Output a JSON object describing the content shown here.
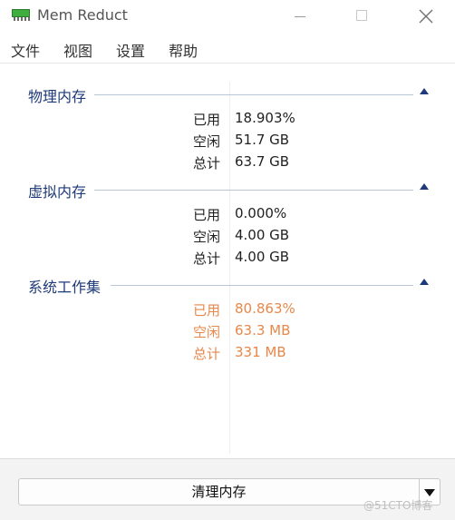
{
  "window": {
    "title": "Mem Reduct"
  },
  "menu": [
    "文件",
    "视图",
    "设置",
    "帮助"
  ],
  "groups": [
    {
      "title": "物理内存",
      "rows": [
        {
          "label": "已用",
          "value": "18.903%"
        },
        {
          "label": "空闲",
          "value": "51.7 GB"
        },
        {
          "label": "总计",
          "value": "63.7 GB"
        }
      ]
    },
    {
      "title": "虚拟内存",
      "rows": [
        {
          "label": "已用",
          "value": "0.000%"
        },
        {
          "label": "空闲",
          "value": "4.00 GB"
        },
        {
          "label": "总计",
          "value": "4.00 GB"
        }
      ]
    },
    {
      "title": "系统工作集",
      "rows": [
        {
          "label": "已用",
          "value": "80.863%"
        },
        {
          "label": "空闲",
          "value": "63.3 MB"
        },
        {
          "label": "总计",
          "value": "331 MB"
        }
      ]
    }
  ],
  "footer": {
    "clean_label": "清理内存",
    "watermark": "@51CTO博客"
  },
  "colors": {
    "group_title": "#1f3a78",
    "warning_values": "#e8874a",
    "app_icon": "#3fae3f"
  },
  "icons": {
    "app": "memory-chip-icon",
    "collapse": "chevron-up-icon",
    "dropdown": "caret-down-icon",
    "close": "close-icon",
    "minimize": "minimize-icon",
    "maximize": "maximize-icon"
  }
}
